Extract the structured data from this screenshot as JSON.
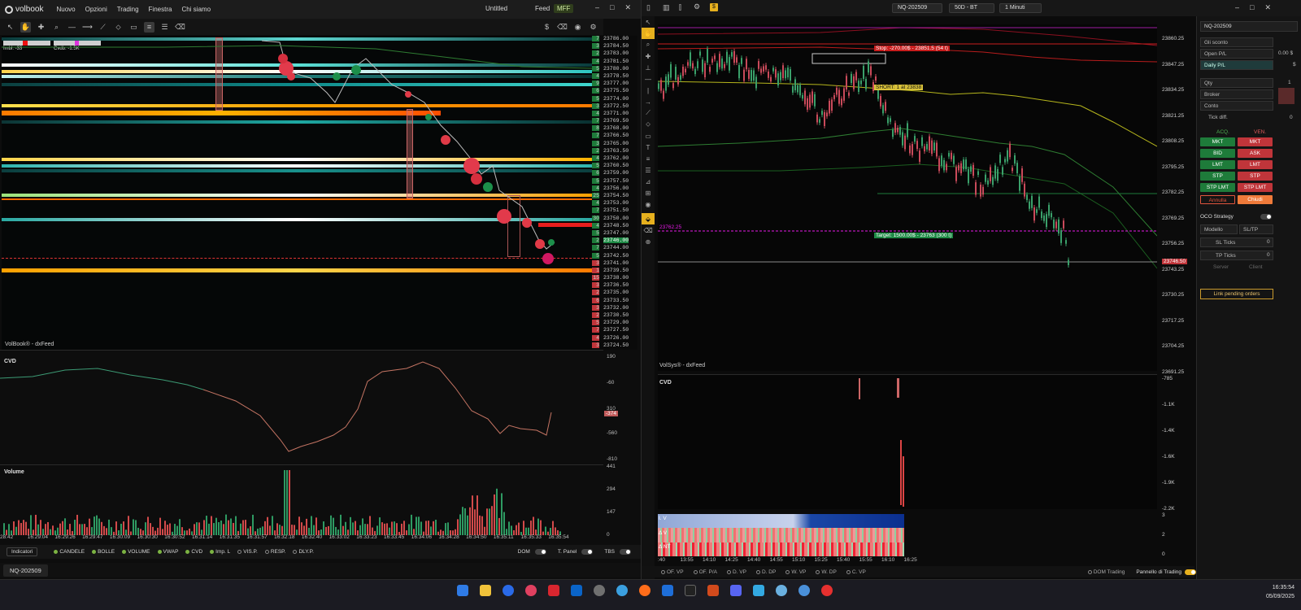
{
  "left": {
    "logo": "volbook",
    "menu": [
      "Nuovo",
      "Opzioni",
      "Trading",
      "Finestra",
      "Chi siamo"
    ],
    "workspace": "Untitled",
    "feed_label": "Feed",
    "feed_value": "MFF",
    "imbal_label": "Imbl: -33",
    "cvdb_label": "Cvdb: -1.5K",
    "heatmap_footer": "VolBook® - dxFeed",
    "cvd_label": "CVD",
    "cvd_axis": [
      "190",
      "-60",
      "310",
      "-560",
      "-810"
    ],
    "cvd_value": "-374",
    "volume_label": "Volume",
    "volume_axis": [
      "441",
      "294",
      "147",
      "0"
    ],
    "x_ticks": [
      "28:42",
      "16:29:04",
      "16:29:26",
      "16:29:47",
      "16:30:09",
      "16:30:30",
      "16:30:52",
      "16:31:14",
      "16:31:35",
      "16:31:57",
      "16:32:18",
      "16:32:40",
      "16:33:02",
      "16:33:23",
      "16:33:45",
      "16:34:06",
      "16:34:28",
      "16:34:50",
      "16:35:11",
      "16:35:33",
      "16:35:54"
    ],
    "ladder_prices": [
      "23786.00",
      "23784.50",
      "23783.00",
      "23781.50",
      "23780.00",
      "23778.50",
      "23777.00",
      "23775.50",
      "23774.00",
      "23772.50",
      "23771.00",
      "23769.50",
      "23768.00",
      "23766.50",
      "23765.00",
      "23763.50",
      "23762.00",
      "23760.50",
      "23759.00",
      "23757.50",
      "23756.00",
      "23754.50",
      "23753.00",
      "23751.50",
      "23750.00",
      "23748.50",
      "23747.00",
      "23746.00",
      "23744.00",
      "23742.50",
      "23741.00",
      "23739.50",
      "23738.00",
      "23736.50",
      "23735.00",
      "23733.50",
      "23732.00",
      "23730.50",
      "23729.00",
      "23727.50",
      "23726.00",
      "23724.50"
    ],
    "ladder_sizes": [
      "7",
      "3",
      "2",
      "4",
      "5",
      "4",
      "9",
      "6",
      "5",
      "3",
      "4",
      "7",
      "8",
      "7",
      "3",
      "2",
      "4",
      "5",
      "6",
      "5",
      "4",
      "25",
      "4",
      "7",
      "30",
      "4",
      "5",
      "2",
      "7",
      "5",
      "3",
      "1",
      "15",
      "3",
      "2",
      "6",
      "3",
      "2",
      "5",
      "7",
      "4",
      "3"
    ],
    "current_price": "23746.00",
    "bottom": {
      "indicators": "Indicatori",
      "toggles": [
        {
          "label": "CANDELE",
          "on": true
        },
        {
          "label": "BOLLE",
          "on": true
        },
        {
          "label": "VOLUME",
          "on": true
        },
        {
          "label": "VWAP",
          "on": true
        },
        {
          "label": "CVD",
          "on": true
        },
        {
          "label": "Imp. L",
          "on": true
        },
        {
          "label": "VIS.P.",
          "on": false
        },
        {
          "label": "RESP.",
          "on": false
        },
        {
          "label": "DLY.P.",
          "on": false
        }
      ],
      "dom": "DOM",
      "tpanel": "T. Panel",
      "tbs": "TBS"
    },
    "symbol_tab": "NQ-202509"
  },
  "right": {
    "symbol": "NQ-202509",
    "range": "50D - BT",
    "timeframe": "1 Minuti",
    "price_axis": [
      "23860.25",
      "23847.25",
      "23834.25",
      "23821.25",
      "23808.25",
      "23795.25",
      "23782.25",
      "23769.25",
      "23756.25",
      "23743.25",
      "23730.25",
      "23717.25",
      "23704.25",
      "23691.25"
    ],
    "current_price": "23746.50",
    "stop_label": "Stop: -270.00$ - 23851.5 (54 t)",
    "short_label": "SHORT: 1 at 23838",
    "target_label": "Target: 1500.00$ - 23763 (300 t)",
    "ref_price_label": "23762.25",
    "footer": "VolSys® - dxFeed",
    "cvd_label": "CVD",
    "cvd_axis": [
      "-785",
      "-1.1K",
      "-1.4K",
      "-1.6K",
      "-1.9K",
      "-2.2K"
    ],
    "heat_rows": [
      "I. V",
      "Δ V",
      "Δ NT"
    ],
    "heat_axis": [
      "3",
      "2",
      "0"
    ],
    "x_ticks": [
      ":40",
      "13:55",
      "14:10",
      "14:25",
      "14:40",
      "14:55",
      "15:10",
      "15:25",
      "15:40",
      "15:55",
      "16:10",
      "16:25"
    ],
    "bottom_toggles": [
      "OF. VP",
      "OF. P/A",
      "D. VP",
      "D. DP",
      "W. VP",
      "W. DP",
      "C. VP"
    ],
    "dom_trading": "DOM Trading",
    "pannello": "Pannello di Trading"
  },
  "tpanel": {
    "symbol": "NQ-202509",
    "fields": [
      "Gli sconto",
      "Open P/L",
      "Daily P/L",
      "Qty",
      "Broker",
      "Conto"
    ],
    "open_pl": "0.00 $",
    "daily_val": "$",
    "qty": "1",
    "tick_diff": "Tick diff.",
    "tick_val": "0",
    "acq": "ACQ.",
    "ven": "VEN.",
    "buttons_buy": [
      "MKT",
      "BID",
      "LMT",
      "STP",
      "STP LMT"
    ],
    "buttons_sell": [
      "MKT",
      "ASK",
      "LMT",
      "STP",
      "STP LMT"
    ],
    "annulla": "Annulla",
    "chiudi": "Chiudi",
    "oco": "OCO Strategy",
    "modello": "Modello",
    "modello_val": "SL/TP",
    "sl_ticks": "SL Ticks",
    "tp_ticks": "TP Ticks",
    "sl_val": "0",
    "tp_val": "0",
    "server": "Server",
    "client": "Client",
    "link": "Link pending orders"
  },
  "taskbar": {
    "time": "16:35:54",
    "date": "05/09/2025"
  },
  "colors": {
    "green": "#1e8a45",
    "red": "#d2373d",
    "teal": "#0e8a8a",
    "orange": "#ff7a00",
    "yellow": "#f1c232",
    "magenta": "#e619e6"
  }
}
